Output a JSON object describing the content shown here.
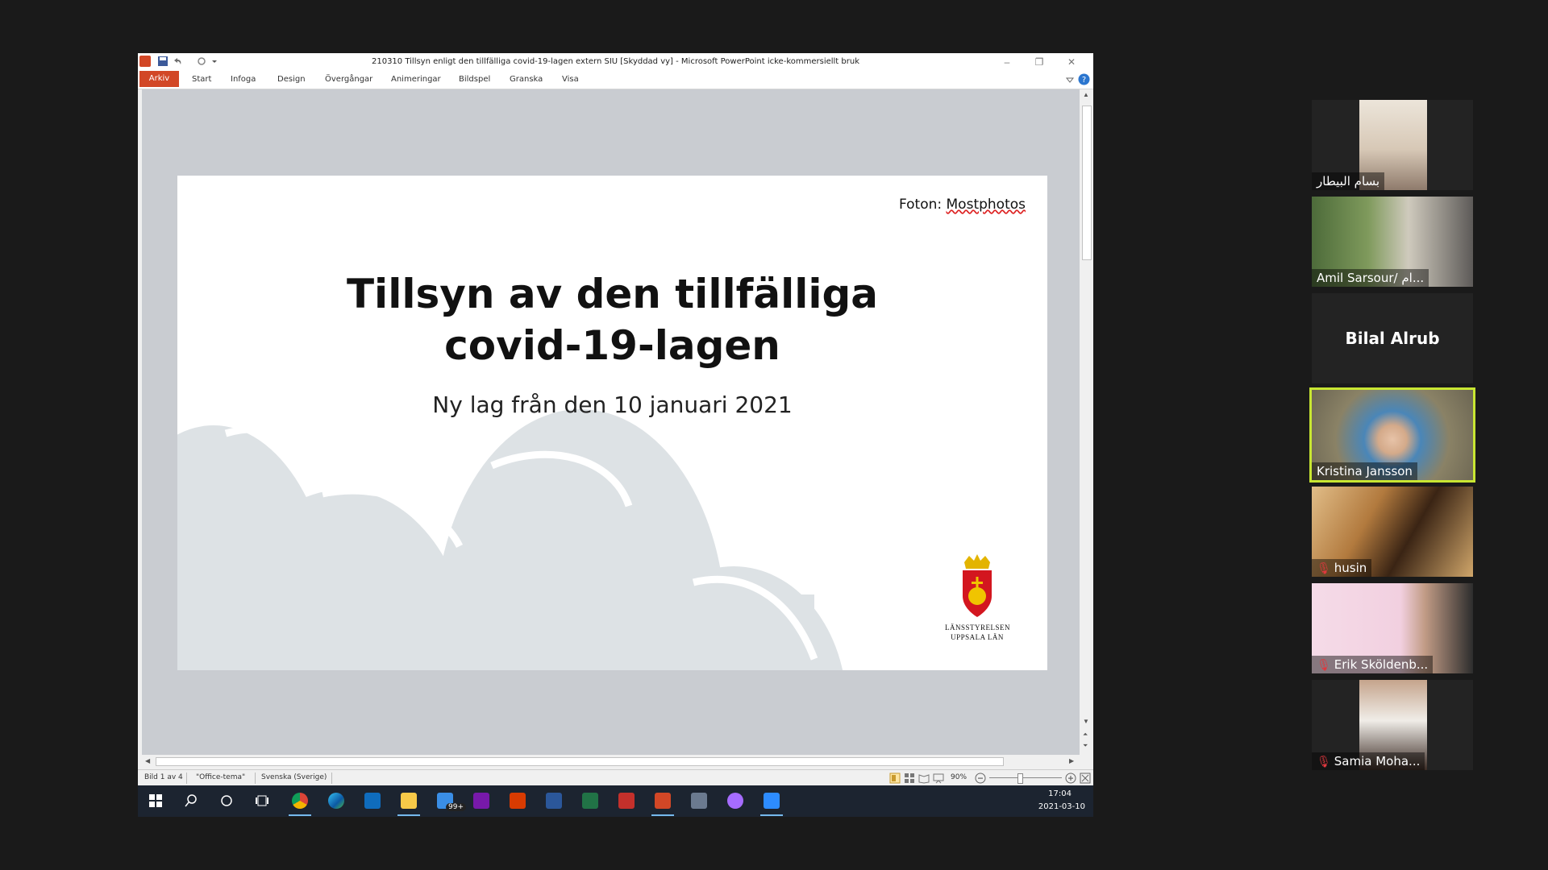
{
  "window": {
    "title": "210310 Tillsyn enligt den tillfälliga covid-19-lagen extern SIU [Skyddad vy] - Microsoft PowerPoint icke-kommersiellt bruk"
  },
  "ribbon": {
    "tabs": [
      "Arkiv",
      "Start",
      "Infoga",
      "Design",
      "Övergångar",
      "Animeringar",
      "Bildspel",
      "Granska",
      "Visa"
    ]
  },
  "slide": {
    "photo_credit_prefix": "Foton: ",
    "photo_credit_link": "Mostphotos",
    "title_line1": "Tillsyn av den tillfälliga",
    "title_line2": "covid-19-lagen",
    "subtitle": "Ny lag från den 10 januari 2021",
    "logo_line1": "LÄNSSTYRELSEN",
    "logo_line2": "UPPSALA LÄN"
  },
  "statusbar": {
    "slide_info": "Bild 1 av 4",
    "theme": "\"Office-tema\"",
    "language": "Svenska (Sverige)",
    "zoom": "90%"
  },
  "taskbar": {
    "time": "17:04",
    "date": "2021-03-10",
    "mail_badge": "99+"
  },
  "participants": [
    {
      "name": "بسام البيطار",
      "muted": false
    },
    {
      "name": "Amil Sarsour/ ام...",
      "muted": false
    },
    {
      "name": "Bilal Alrub",
      "muted": false,
      "video_off": true
    },
    {
      "name": "Kristina Jansson",
      "muted": false,
      "active_speaker": true
    },
    {
      "name": "husin",
      "muted": true
    },
    {
      "name": "Erik Sköldenb...",
      "muted": true
    },
    {
      "name": "Samia Moha...",
      "muted": true
    }
  ],
  "colors": {
    "file_tab": "#d24726",
    "active_speaker": "#c8e632",
    "taskbar": "#1c2430",
    "cloud": "#dde2e5"
  }
}
